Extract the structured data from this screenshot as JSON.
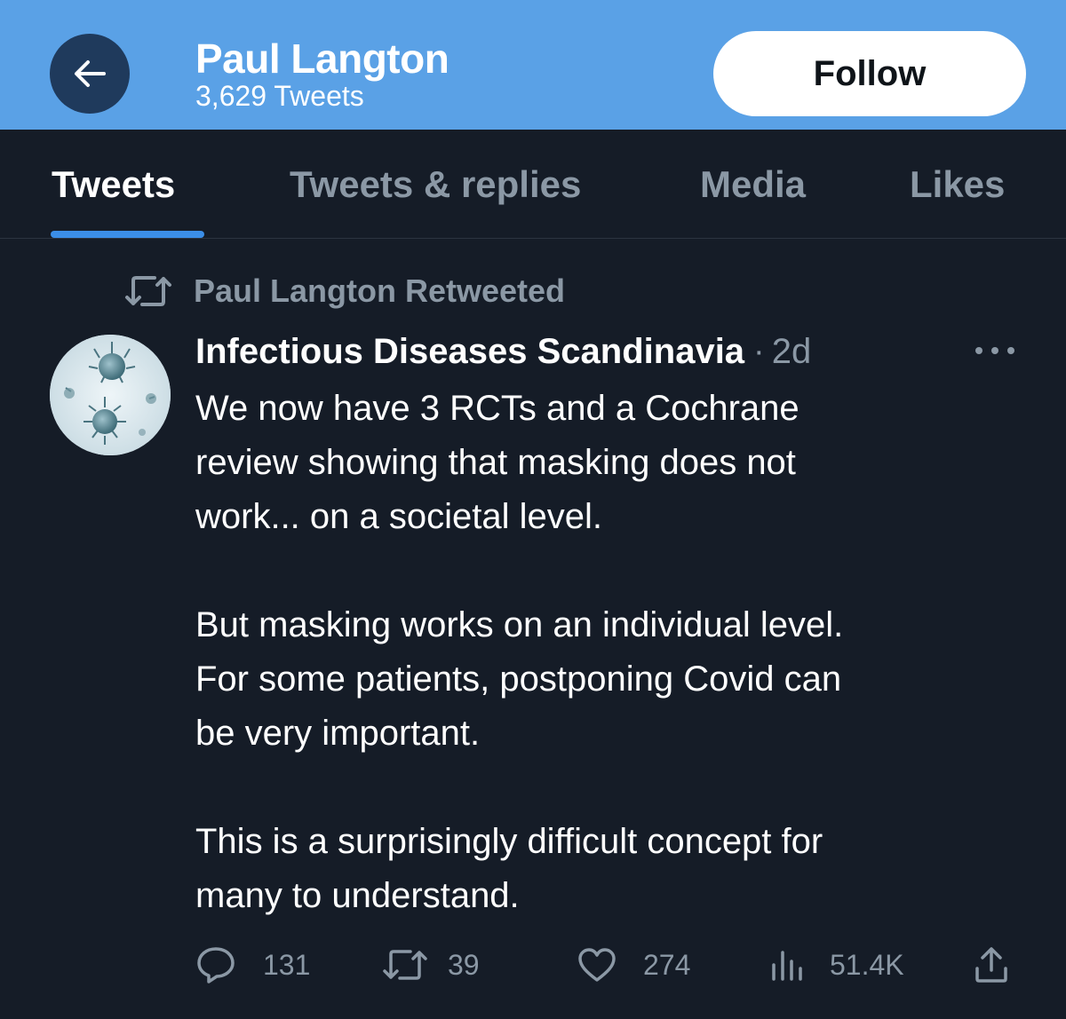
{
  "header": {
    "back_icon": "arrow-left-icon",
    "title": "Paul Langton",
    "subtitle": "3,629 Tweets",
    "follow_label": "Follow",
    "bg_color": "#5aa1e6"
  },
  "tabs": [
    {
      "label": "Tweets",
      "active": true
    },
    {
      "label": "Tweets & replies",
      "active": false
    },
    {
      "label": "Media",
      "active": false
    },
    {
      "label": "Likes",
      "active": false
    }
  ],
  "tweet": {
    "retweet_icon": "retweet-icon",
    "retweet_note": "Paul Langton Retweeted",
    "avatar_icon": "virus-avatar-icon",
    "author": "Infectious Diseases Scandinavia",
    "separator": "·",
    "time": "2d",
    "more_icon": "more-icon",
    "paragraphs": [
      "We now have 3 RCTs and a Cochrane\nreview showing that masking does not\nwork... on a societal level.",
      "But masking works on an individual level.\nFor some patients, postponing Covid can\nbe very important.",
      "This is a surprisingly difficult concept for\nmany to understand."
    ],
    "actions": {
      "replies": {
        "icon": "reply-icon",
        "count": "131"
      },
      "retweets": {
        "icon": "retweet-icon",
        "count": "39"
      },
      "likes": {
        "icon": "heart-icon",
        "count": "274"
      },
      "views": {
        "icon": "views-icon",
        "count": "51.4K"
      },
      "share": {
        "icon": "share-icon"
      }
    }
  },
  "colors": {
    "background": "#151c27",
    "accent": "#3b8ee8",
    "muted": "#8b98a5"
  }
}
